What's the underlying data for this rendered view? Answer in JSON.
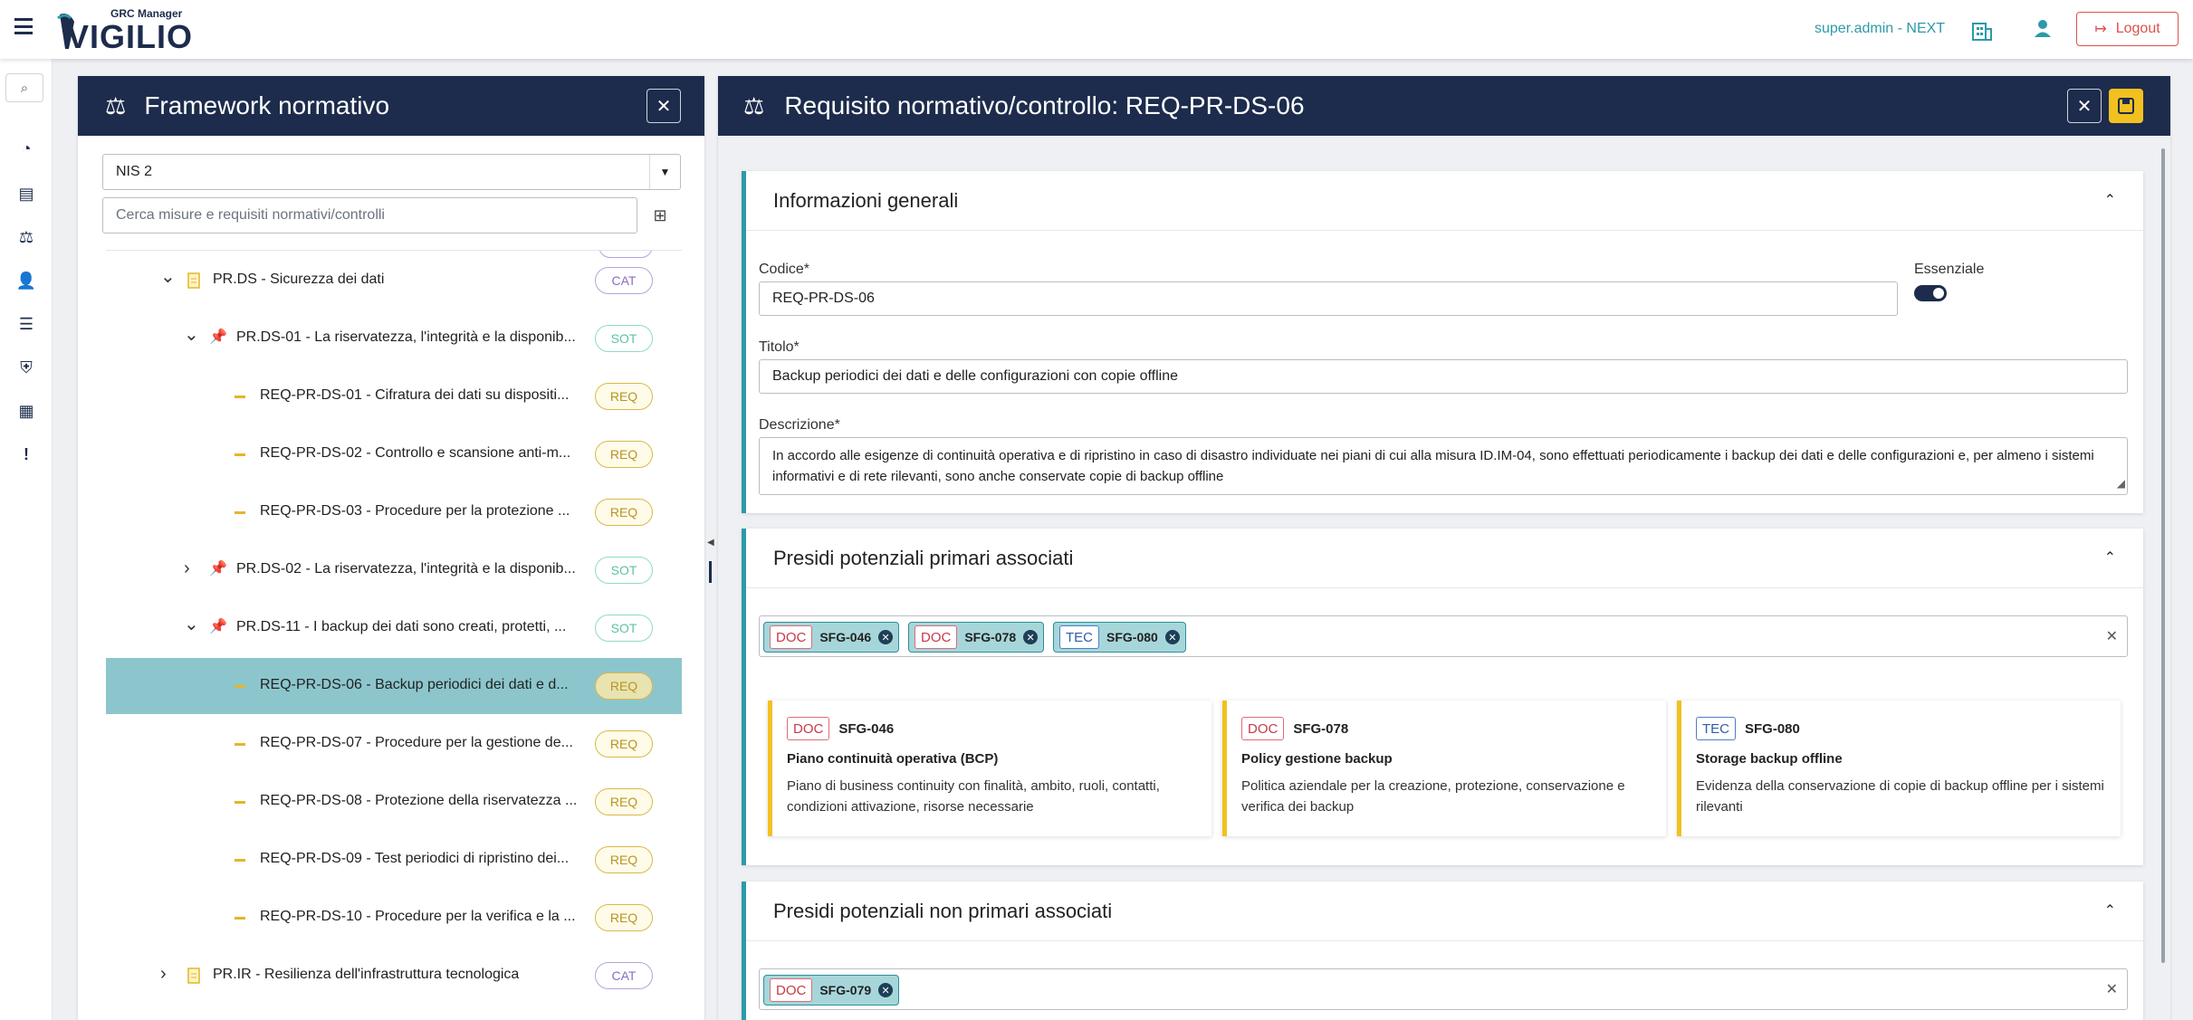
{
  "app": {
    "logo_small": "GRC Manager",
    "logo_big": "VIGILIO",
    "user": "super.admin - NEXT",
    "logout": "Logout"
  },
  "colors": {
    "navy": "#1d2c4c",
    "teal": "#2c9aa8",
    "accent_yellow": "#f2c120",
    "selected_row": "#8cc6cc"
  },
  "sidebar": {
    "icons": [
      "search-icon",
      "dashboard-icon",
      "book-icon",
      "scale-icon",
      "user-list-icon",
      "checklist-icon",
      "shield-icon",
      "report-icon",
      "alert-icon"
    ]
  },
  "left": {
    "title": "Framework normativo",
    "framework_select": "NIS 2",
    "search_placeholder": "Cerca misure e requisiti normativi/controlli",
    "tree": [
      {
        "label": "PR.DS - Sicurezza dei dati",
        "badge": "CAT",
        "level": 0,
        "expanded": true
      },
      {
        "label": "PR.DS-01 - La riservatezza, l'integrità e la disponib...",
        "badge": "SOT",
        "level": 1,
        "expanded": true
      },
      {
        "label": "REQ-PR-DS-01 - Cifratura dei dati su dispositi...",
        "badge": "REQ",
        "level": 2
      },
      {
        "label": "REQ-PR-DS-02 - Controllo e scansione anti-m...",
        "badge": "REQ",
        "level": 2
      },
      {
        "label": "REQ-PR-DS-03 - Procedure per la protezione ...",
        "badge": "REQ",
        "level": 2
      },
      {
        "label": "PR.DS-02 - La riservatezza, l'integrità e la disponib...",
        "badge": "SOT",
        "level": 1,
        "expanded": false
      },
      {
        "label": "PR.DS-11 - I backup dei dati sono creati, protetti, ...",
        "badge": "SOT",
        "level": 1,
        "expanded": true
      },
      {
        "label": "REQ-PR-DS-06 - Backup periodici dei dati e d...",
        "badge": "REQ",
        "level": 2,
        "selected": true
      },
      {
        "label": "REQ-PR-DS-07 - Procedure per la gestione de...",
        "badge": "REQ",
        "level": 2
      },
      {
        "label": "REQ-PR-DS-08 - Protezione della riservatezza ...",
        "badge": "REQ",
        "level": 2
      },
      {
        "label": "REQ-PR-DS-09 - Test periodici di ripristino dei...",
        "badge": "REQ",
        "level": 2
      },
      {
        "label": "REQ-PR-DS-10 - Procedure per la verifica e la ...",
        "badge": "REQ",
        "level": 2
      },
      {
        "label": "PR.IR - Resilienza dell'infrastruttura tecnologica",
        "badge": "CAT",
        "level": 0,
        "expanded": false
      }
    ]
  },
  "right": {
    "title": "Requisito normativo/controllo: REQ-PR-DS-06",
    "general": {
      "title": "Informazioni generali",
      "codice_label": "Codice*",
      "codice": "REQ-PR-DS-06",
      "essenziale_label": "Essenziale",
      "titolo_label": "Titolo*",
      "titolo": "Backup periodici dei dati e delle configurazioni con copie offline",
      "descrizione_label": "Descrizione*",
      "descrizione": "In accordo alle esigenze di continuità operativa e di ripristino in caso di disastro individuate nei piani di cui alla misura ID.IM-04, sono effettuati periodicamente i backup dei dati e delle configurazioni e, per almeno i sistemi informativi e di rete rilevanti, sono anche conservate copie di backup offline"
    },
    "primary": {
      "title": "Presidi potenziali primari associati",
      "chips": [
        {
          "tag": "DOC",
          "code": "SFG-046"
        },
        {
          "tag": "DOC",
          "code": "SFG-078"
        },
        {
          "tag": "TEC",
          "code": "SFG-080"
        }
      ],
      "cards": [
        {
          "tag": "DOC",
          "code": "SFG-046",
          "title": "Piano continuità operativa (BCP)",
          "desc": "Piano di business continuity con finalità, ambito, ruoli, contatti, condizioni attivazione, risorse necessarie"
        },
        {
          "tag": "DOC",
          "code": "SFG-078",
          "title": "Policy gestione backup",
          "desc": "Politica aziendale per la creazione, protezione, conservazione e verifica dei backup"
        },
        {
          "tag": "TEC",
          "code": "SFG-080",
          "title": "Storage backup offline",
          "desc": "Evidenza della conservazione di copie di backup offline per i sistemi rilevanti"
        }
      ]
    },
    "nonprimary": {
      "title": "Presidi potenziali non primari associati",
      "chips": [
        {
          "tag": "DOC",
          "code": "SFG-079"
        }
      ]
    }
  }
}
